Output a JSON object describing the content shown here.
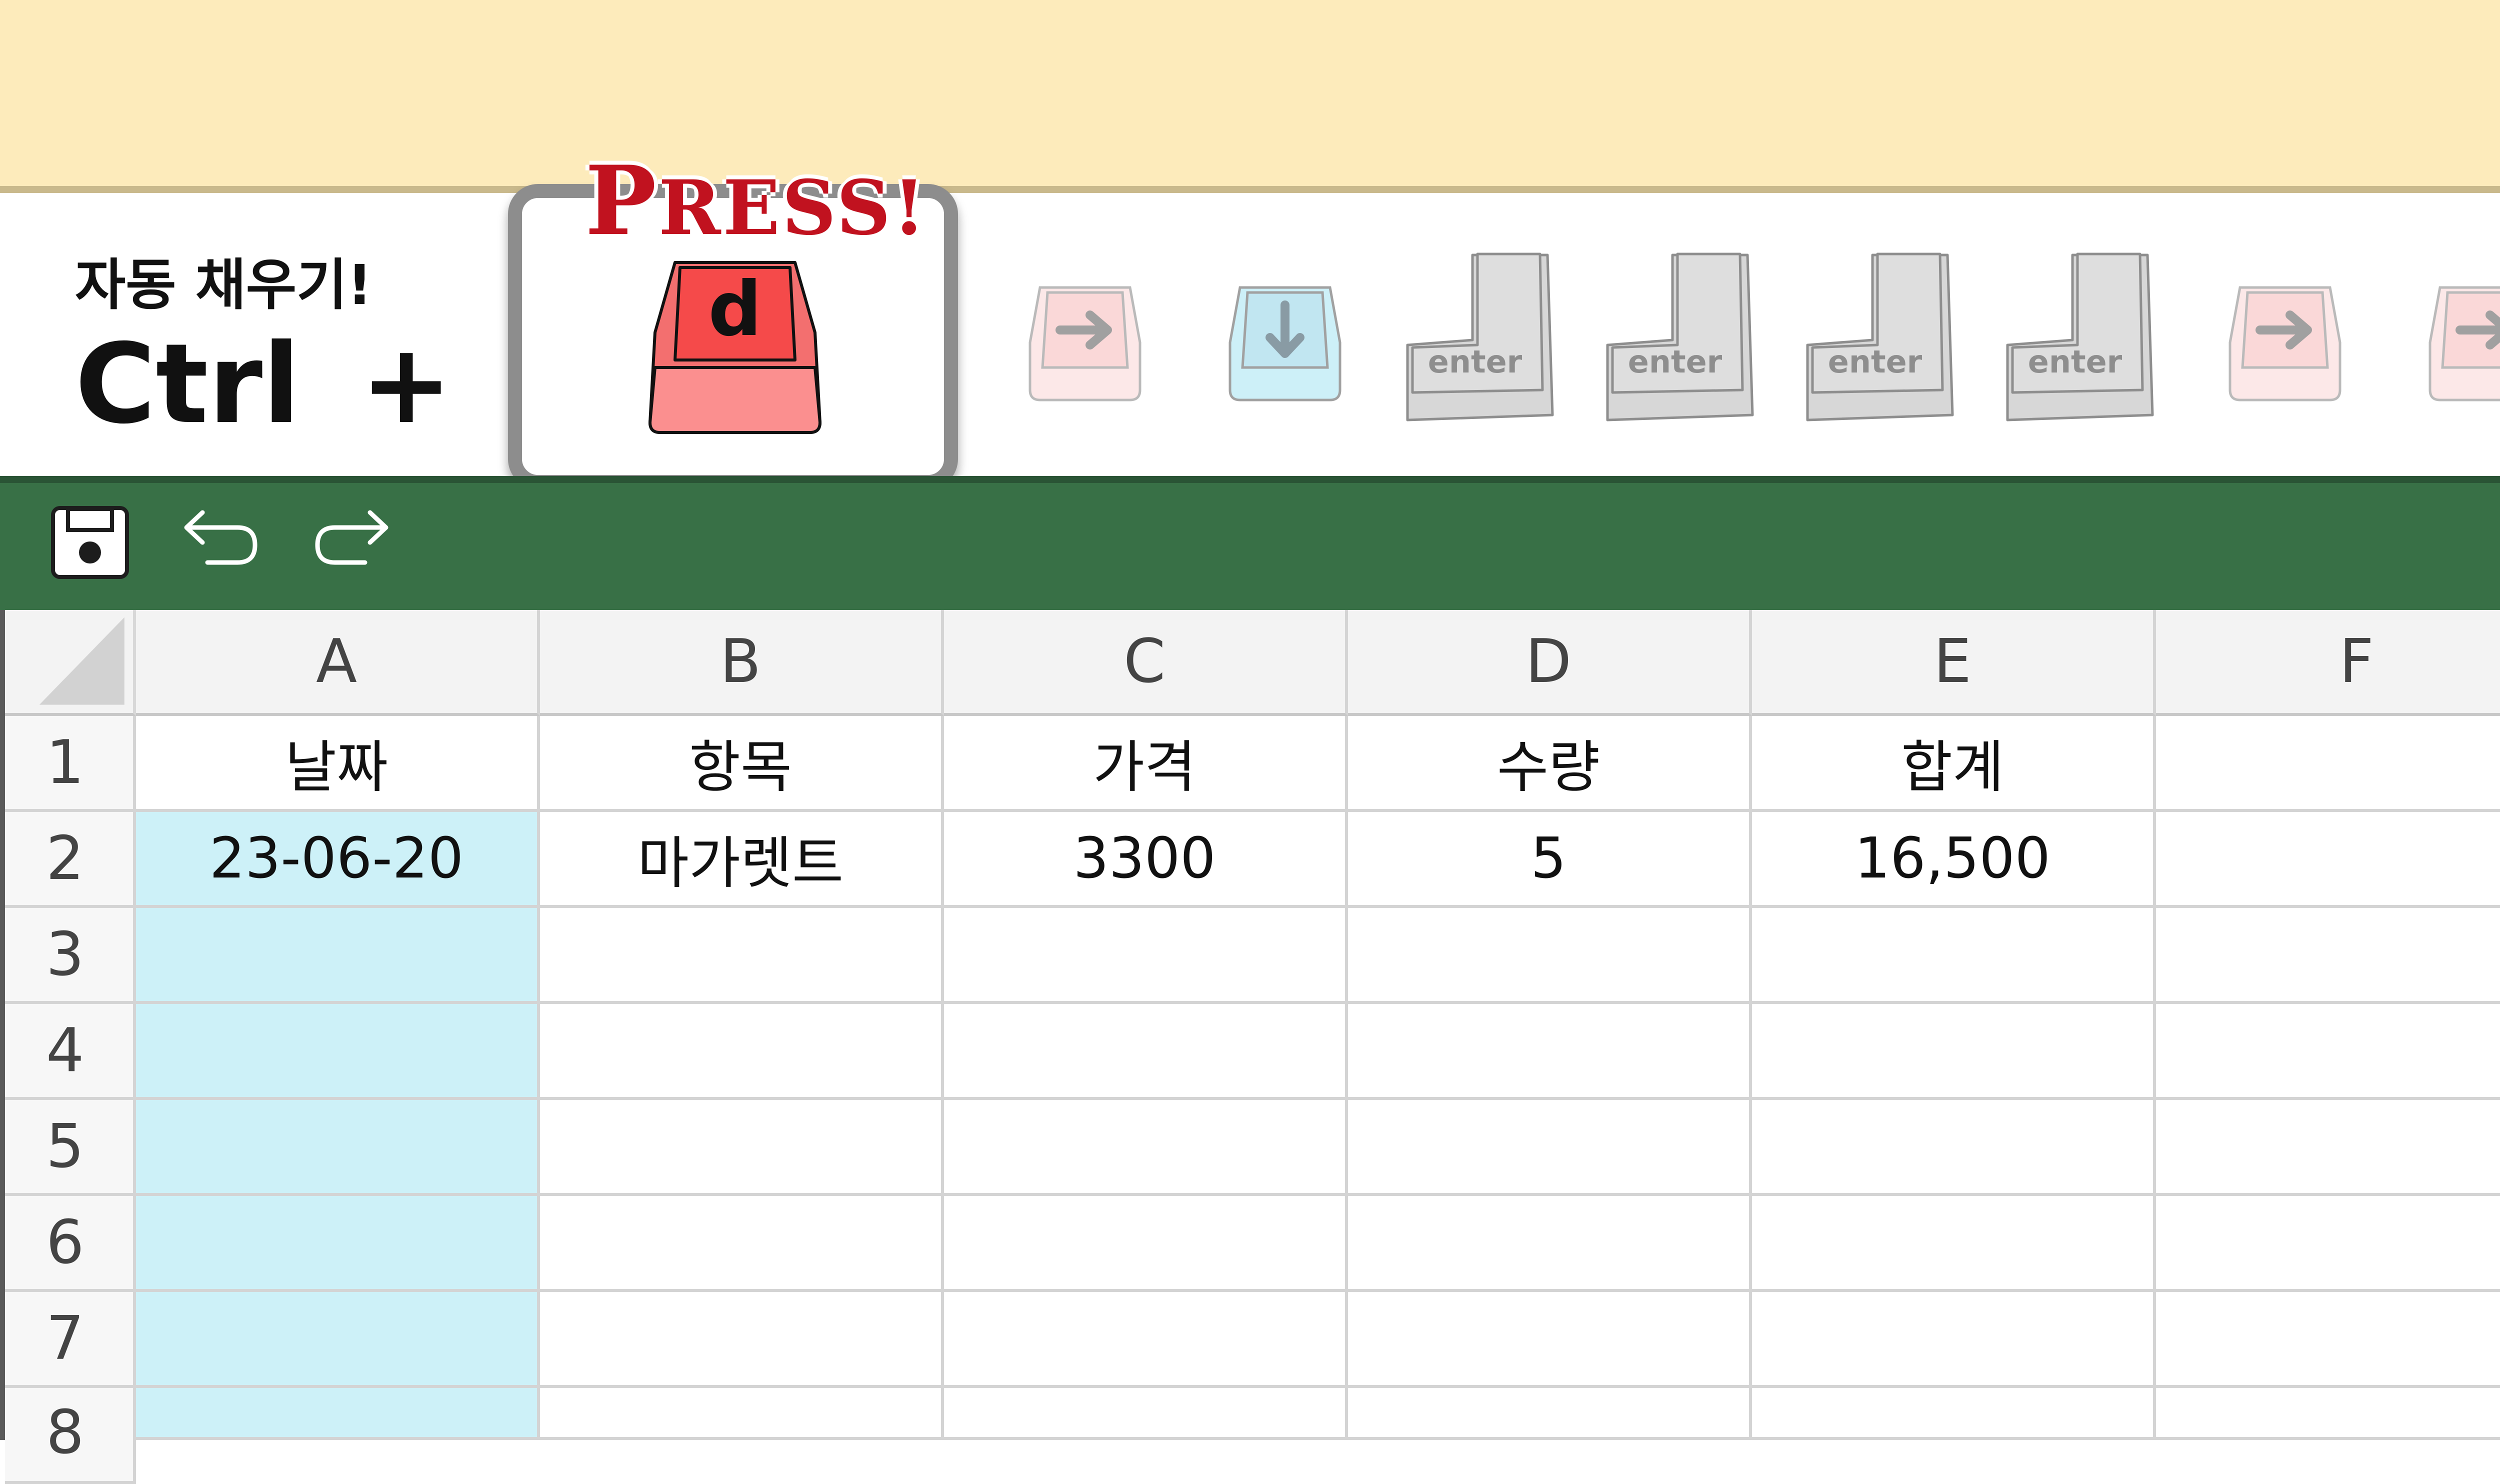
{
  "instruction": {
    "title": "자동 채우기!",
    "modifier": "Ctrl",
    "plus": "+"
  },
  "press_card": {
    "label_first": "P",
    "label_rest": "RESS!",
    "key": "d"
  },
  "key_sequence": [
    {
      "type": "arrow-right",
      "state": "dim"
    },
    {
      "type": "arrow-down",
      "state": "dim"
    },
    {
      "type": "enter",
      "label": "enter",
      "state": "dim"
    },
    {
      "type": "enter",
      "label": "enter",
      "state": "dim"
    },
    {
      "type": "enter",
      "label": "enter",
      "state": "dim"
    },
    {
      "type": "enter",
      "label": "enter",
      "state": "dim"
    },
    {
      "type": "arrow-right",
      "state": "dim"
    },
    {
      "type": "arrow-right",
      "state": "dim"
    }
  ],
  "toolbar": {
    "icons": [
      "save-icon",
      "undo-icon",
      "redo-icon"
    ]
  },
  "spreadsheet": {
    "columns": [
      "A",
      "B",
      "C",
      "D",
      "E",
      "F"
    ],
    "rows": [
      "1",
      "2",
      "3",
      "4",
      "5",
      "6",
      "7",
      "8"
    ],
    "cells": [
      [
        "날짜",
        "항목",
        "가격",
        "수량",
        "합계",
        ""
      ],
      [
        "23-06-20",
        "마가렛트",
        "3300",
        "5",
        "16,500",
        ""
      ],
      [
        "",
        "",
        "",
        "",
        "",
        ""
      ],
      [
        "",
        "",
        "",
        "",
        "",
        ""
      ],
      [
        "",
        "",
        "",
        "",
        "",
        ""
      ],
      [
        "",
        "",
        "",
        "",
        "",
        ""
      ],
      [
        "",
        "",
        "",
        "",
        "",
        ""
      ],
      [
        "",
        "",
        "",
        "",
        "",
        ""
      ]
    ],
    "selected_range": "A2:A8"
  },
  "colors": {
    "banner": "#fdebbb",
    "ribbon": "#387046",
    "selection": "#cdf1f8",
    "press_red": "#c1121f",
    "key_red": "#f26b6b",
    "key_blue": "#bfe9f4",
    "key_gray": "#d6d6d6"
  }
}
